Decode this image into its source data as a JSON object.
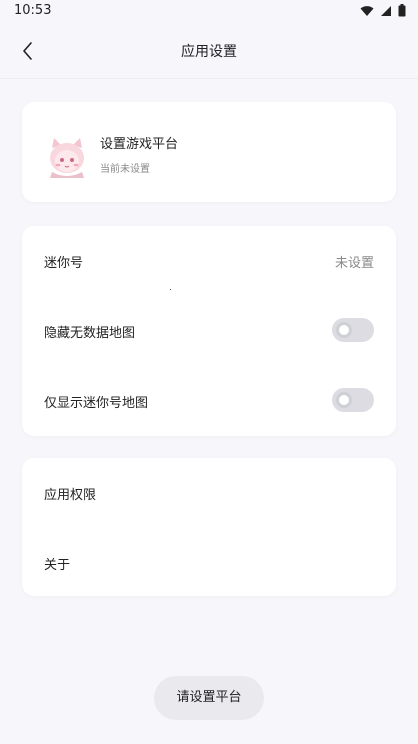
{
  "status_bar": {
    "time": "10:53",
    "icons": [
      "wifi-icon",
      "signal-icon",
      "battery-icon"
    ]
  },
  "header": {
    "title": "应用设置",
    "back_icon": "chevron-left-icon"
  },
  "platform_card": {
    "title": "设置游戏平台",
    "subtitle": "当前未设置"
  },
  "settings": {
    "mini_id": {
      "label": "迷你号",
      "value": "未设置"
    },
    "hide_empty_maps": {
      "label": "隐藏无数据地图",
      "enabled": false
    },
    "show_mini_maps": {
      "label": "仅显示迷你号地图",
      "enabled": false
    }
  },
  "misc": {
    "permissions_label": "应用权限",
    "about_label": "关于"
  },
  "toast": {
    "text": "请设置平台"
  },
  "colors": {
    "background": "#f7f7fb",
    "card": "#ffffff",
    "toggle_off": "#dcdce2",
    "muted_text": "#8a8a8a"
  }
}
